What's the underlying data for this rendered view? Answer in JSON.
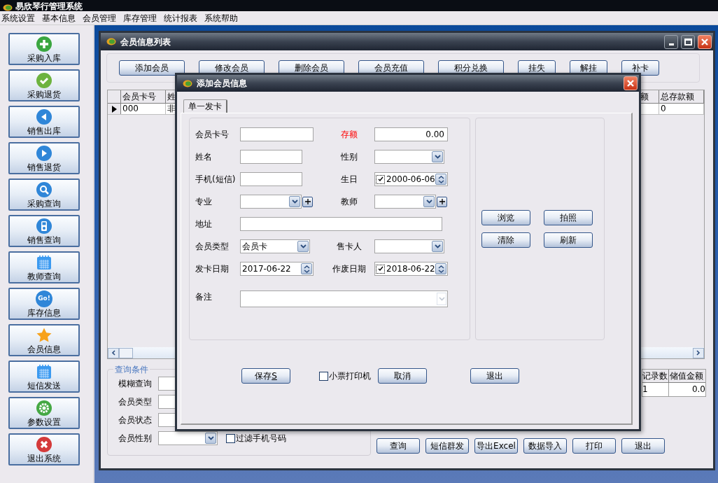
{
  "app": {
    "title": "易欣琴行管理系统"
  },
  "menu": [
    "系统设置",
    "基本信息",
    "会员管理",
    "库存管理",
    "统计报表",
    "系统帮助"
  ],
  "sidebar": [
    {
      "label": "采购入库",
      "kind": "plus"
    },
    {
      "label": "采购退货",
      "kind": "check"
    },
    {
      "label": "销售出库",
      "kind": "left"
    },
    {
      "label": "销售退货",
      "kind": "right"
    },
    {
      "label": "采购查询",
      "kind": "search"
    },
    {
      "label": "销售查询",
      "kind": "player"
    },
    {
      "label": "教师查询",
      "kind": "calendar"
    },
    {
      "label": "库存信息",
      "kind": "go",
      "icon_text": "Go!"
    },
    {
      "label": "会员信息",
      "kind": "star"
    },
    {
      "label": "短信发送",
      "kind": "calendar"
    },
    {
      "label": "参数设置",
      "kind": "gear"
    },
    {
      "label": "退出系统",
      "kind": "close"
    }
  ],
  "member_window": {
    "title": "会员信息列表",
    "toolbar": [
      "添加会员",
      "修改会员",
      "删除会员",
      "会员充值",
      "积分兑换",
      "挂失",
      "解挂",
      "补卡"
    ],
    "table": {
      "columns": [
        "会员卡号",
        "姓",
        "额",
        "总存款额"
      ],
      "rows": [
        {
          "current": true,
          "cells": [
            "000",
            "非",
            "",
            "0"
          ]
        }
      ]
    },
    "filter": {
      "legend": "查询条件",
      "fields": [
        {
          "label": "模糊查询",
          "kind": "text"
        },
        {
          "label": "会员类型",
          "kind": "text"
        },
        {
          "label": "会员状态",
          "kind": "text"
        },
        {
          "label": "会员性别",
          "kind": "combo"
        }
      ],
      "filter_phone": {
        "label": "过滤手机号码",
        "checked": false
      }
    },
    "summary": {
      "columns": [
        "记录数",
        "储值金额"
      ],
      "values": [
        "1",
        "0.0"
      ]
    },
    "actions": [
      "查询",
      "短信群发",
      "导出Excel",
      "数据导入",
      "打印",
      "退出"
    ]
  },
  "dialog": {
    "title": "添加会员信息",
    "tabs": [
      {
        "label": "单一发卡",
        "selected": true
      }
    ],
    "rows": [
      {
        "fields": [
          {
            "label": "会员卡号",
            "kind": "text",
            "highlight": false
          },
          {
            "label": "存额",
            "kind": "amount",
            "value": "0.00",
            "highlight": true
          }
        ]
      },
      {
        "fields": [
          {
            "label": "姓名",
            "kind": "short_text",
            "highlight": false
          },
          {
            "label": "性别",
            "kind": "combo",
            "highlight": false
          }
        ]
      },
      {
        "fields": [
          {
            "label": "手机(短信)",
            "kind": "short_text",
            "highlight": false
          },
          {
            "label": "生日",
            "kind": "date_check",
            "value": "2000-06-06",
            "checked": true,
            "highlight": false
          }
        ]
      },
      {
        "fields": [
          {
            "label": "专业",
            "kind": "combo_add",
            "highlight": false
          },
          {
            "label": "教师",
            "kind": "combo_add",
            "highlight": false
          }
        ]
      },
      {
        "fields": [
          {
            "label": "地址",
            "kind": "wide_text",
            "highlight": false
          }
        ]
      },
      {
        "fields": [
          {
            "label": "会员类型",
            "kind": "combo",
            "value": "会员卡",
            "highlight": false
          },
          {
            "label": "售卡人",
            "kind": "combo",
            "highlight": false
          }
        ]
      },
      {
        "fields": [
          {
            "label": "发卡日期",
            "kind": "date",
            "value": "2017-06-22",
            "highlight": false
          },
          {
            "label": "作废日期",
            "kind": "date_check",
            "value": "2018-06-22",
            "checked": true,
            "highlight": false
          }
        ]
      },
      {
        "fields": [
          {
            "label": "备注",
            "kind": "memo",
            "highlight": false
          }
        ]
      }
    ],
    "photo_buttons": [
      "浏览",
      "拍照",
      "清除",
      "刷新"
    ],
    "save_button": {
      "label": "保存",
      "accesskey": "S"
    },
    "print_receipt": {
      "label": "小票打印机",
      "checked": false
    },
    "cancel_button": "取消",
    "exit_button": "退出"
  }
}
